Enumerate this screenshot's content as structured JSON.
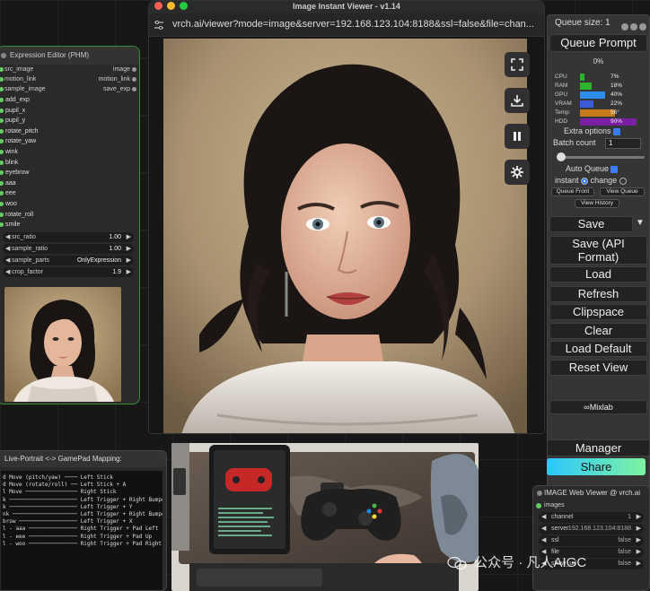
{
  "expression_editor": {
    "title": "Expression Editor (PHM)",
    "io_rows": [
      {
        "in": "src_image",
        "out": "image"
      },
      {
        "in": "motion_link",
        "out": "motion_link"
      },
      {
        "in": "sample_image",
        "out": "save_exp"
      }
    ],
    "bool_inputs": [
      "add_exp",
      "pupil_x",
      "pupil_y",
      "rotate_pitch",
      "rotate_yaw",
      "wink",
      "blink",
      "eyebrow",
      "aaa",
      "eee",
      "woo",
      "rotate_roll",
      "smile"
    ],
    "widgets": [
      {
        "label": "src_ratio",
        "value": "1.00"
      },
      {
        "label": "sample_ratio",
        "value": "1.00"
      },
      {
        "label": "sample_parts",
        "value": "OnlyExpression"
      },
      {
        "label": "crop_factor",
        "value": "1.9"
      }
    ]
  },
  "browser": {
    "window_title": "Image Instant Viewer - v1.14",
    "url": "vrch.ai/viewer?mode=image&server=192.168.123.104:8188&ssl=false&file=chan...",
    "tools": [
      "fullscreen-icon",
      "download-icon",
      "pause-icon",
      "gear-icon"
    ]
  },
  "queue": {
    "queue_size": "Queue size: 1",
    "queue_prompt": "Queue Prompt",
    "progress": "0%",
    "stats": [
      {
        "label": "CPU",
        "value": "7%",
        "color": "#2cb52c",
        "fill": 0.07
      },
      {
        "label": "RAM",
        "value": "18%",
        "color": "#2cb52c",
        "fill": 0.18
      },
      {
        "label": "GPU",
        "value": "40%",
        "color": "#2d8cf0",
        "fill": 0.4
      },
      {
        "label": "VRAM",
        "value": "22%",
        "color": "#3b5bdb",
        "fill": 0.22
      },
      {
        "label": "Temp",
        "value": "56°",
        "color": "#c77a1b",
        "fill": 0.56
      },
      {
        "label": "HDD",
        "value": "90%",
        "color": "#7b1fa2",
        "fill": 0.9
      }
    ],
    "extra_options": "Extra options",
    "batch_count_label": "Batch count",
    "batch_count": "1",
    "auto_queue": "Auto Queue",
    "instant": "instant",
    "change": "change",
    "queue_front": "Queue Front",
    "view_queue": "View Queue",
    "view_history": "View History",
    "buttons": [
      "Save",
      "Save (API Format)",
      "Load",
      "Refresh",
      "Clipspace",
      "Clear",
      "Load Default",
      "Reset View"
    ],
    "save_menu": "▼",
    "mixlab": "∞Mixlab"
  },
  "gamepad": {
    "title": "Live-Portrait <-> GamePad Mapping:",
    "lines": [
      "d Move (pitch/yaw) ──── Left Stick",
      "d Move (rotate/roll) ── Left Stick + A",
      "l Move ──────────────── Right Stick",
      "k ───────────────────── Left Trigger + Right Bumper",
      "k ───────────────────── Left Trigger + Y",
      "nk ──────────────────── Left Trigger + Right Bumper",
      "brow ────────────────── Left Trigger + X",
      "l - aaa ─────────────── Right Trigger + Pad Left",
      "l - eee ─────────────── Right Trigger + Pad Up",
      "l - woo ─────────────── Right Trigger + Pad Right"
    ]
  },
  "manager": "Manager",
  "share": "Share",
  "web_viewer": {
    "title": "IMAGE Web Viewer @ vrch.ai",
    "input": "images",
    "widgets": [
      {
        "label": "channel",
        "value": "1"
      },
      {
        "label": "server",
        "value": "192.168.123.104:8188"
      },
      {
        "label": "ssl",
        "value": "false"
      },
      {
        "label": "file",
        "value": "false"
      },
      {
        "label": "show_url",
        "value": "false"
      }
    ]
  },
  "watermark": "公众号 · 凡人AIGC"
}
